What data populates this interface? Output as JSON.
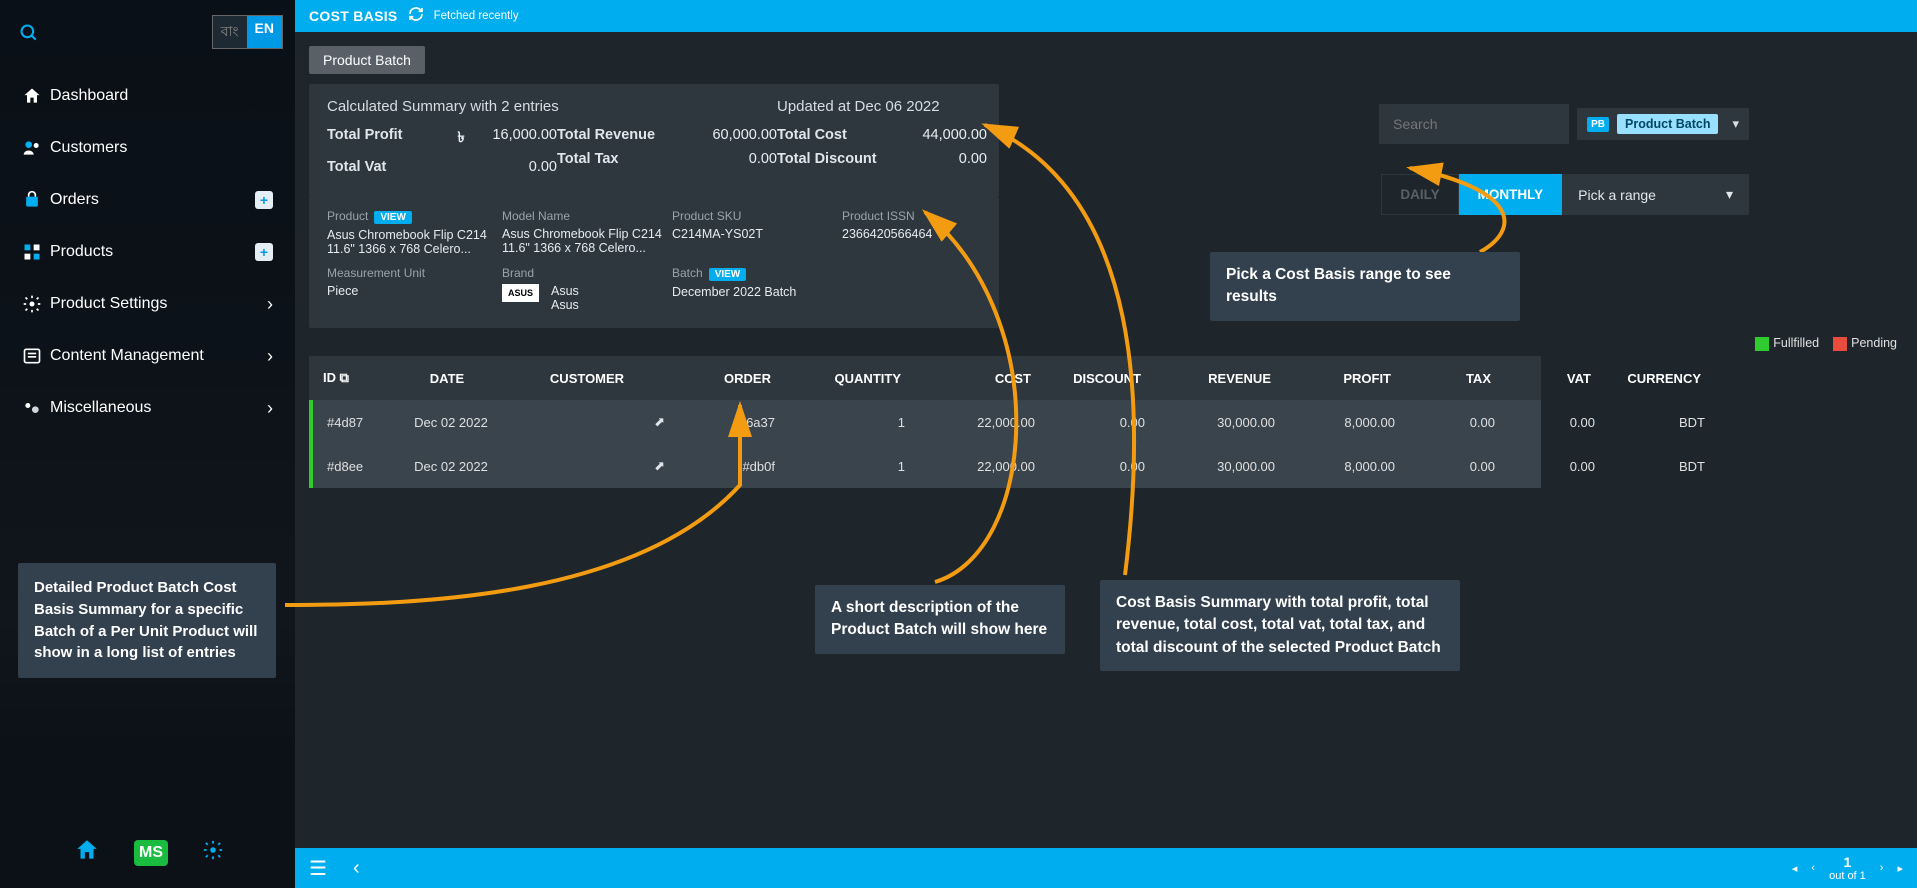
{
  "header": {
    "title": "COST BASIS",
    "fetched": "Fetched recently"
  },
  "lang": {
    "bn": "বাং",
    "en": "EN"
  },
  "nav": {
    "dashboard": "Dashboard",
    "customers": "Customers",
    "orders": "Orders",
    "products": "Products",
    "product_settings": "Product Settings",
    "content_mgmt": "Content Management",
    "misc": "Miscellaneous"
  },
  "tab": {
    "product_batch": "Product Batch"
  },
  "summary": {
    "heading": "Calculated Summary with 2 entries",
    "updated": "Updated at Dec 06 2022",
    "total_profit_lbl": "Total Profit",
    "total_profit_curr": "৳",
    "total_profit": "16,000.00",
    "total_revenue_lbl": "Total Revenue",
    "total_revenue": "60,000.00",
    "total_cost_lbl": "Total Cost",
    "total_cost": "44,000.00",
    "total_vat_lbl": "Total Vat",
    "total_vat": "0.00",
    "total_tax_lbl": "Total Tax",
    "total_tax": "0.00",
    "total_discount_lbl": "Total Discount",
    "total_discount": "0.00"
  },
  "product": {
    "product_lbl": "Product",
    "view": "VIEW",
    "product_val": "Asus Chromebook Flip C214 11.6\" 1366 x 768 Celero...",
    "model_lbl": "Model Name",
    "model_val": "Asus Chromebook Flip C214 11.6\" 1366 x 768 Celero...",
    "sku_lbl": "Product SKU",
    "sku_val": "C214MA-YS02T",
    "issn_lbl": "Product ISSN",
    "issn_val": "2366420566464",
    "mu_lbl": "Measurement Unit",
    "mu_val": "Piece",
    "brand_lbl": "Brand",
    "brand_name": "Asus",
    "brand_name2": "Asus",
    "brand_logo": "ASUS",
    "batch_lbl": "Batch",
    "batch_val": "December 2022 Batch"
  },
  "controls": {
    "search_ph": "Search",
    "pb_badge": "PB",
    "pb_label": "Product Batch",
    "daily": "DAILY",
    "monthly": "MONTHLY",
    "pick_range": "Pick a range"
  },
  "legend": {
    "fullfilled": "Fullfilled",
    "pending": "Pending"
  },
  "table": {
    "cols": {
      "id": "ID",
      "date": "DATE",
      "customer": "CUSTOMER",
      "order": "ORDER",
      "qty": "QUANTITY",
      "cost": "COST",
      "discount": "DISCOUNT",
      "revenue": "REVENUE",
      "profit": "PROFIT",
      "tax": "TAX",
      "vat": "VAT",
      "currency": "CURRENCY"
    },
    "rows": [
      {
        "id": "#4d87",
        "date": "Dec 02 2022",
        "order": "#6a37",
        "qty": "1",
        "cost": "22,000.00",
        "discount": "0.00",
        "revenue": "30,000.00",
        "profit": "8,000.00",
        "tax": "0.00",
        "vat": "0.00",
        "currency": "BDT"
      },
      {
        "id": "#d8ee",
        "date": "Dec 02 2022",
        "order": "#db0f",
        "qty": "1",
        "cost": "22,000.00",
        "discount": "0.00",
        "revenue": "30,000.00",
        "profit": "8,000.00",
        "tax": "0.00",
        "vat": "0.00",
        "currency": "BDT"
      }
    ]
  },
  "footer": {
    "page": "1",
    "outof": "out of 1"
  },
  "annotations": {
    "side": "Detailed Product Batch Cost Basis Summary for a specific Batch of a Per Unit Product will show in a long list of entries",
    "desc": "A short description of the Product Batch will show here",
    "summary": "Cost Basis Summary with total profit, total revenue, total cost, total vat, total tax, and total discount of the selected Product Batch",
    "range": "Pick a Cost Basis range to see results"
  }
}
